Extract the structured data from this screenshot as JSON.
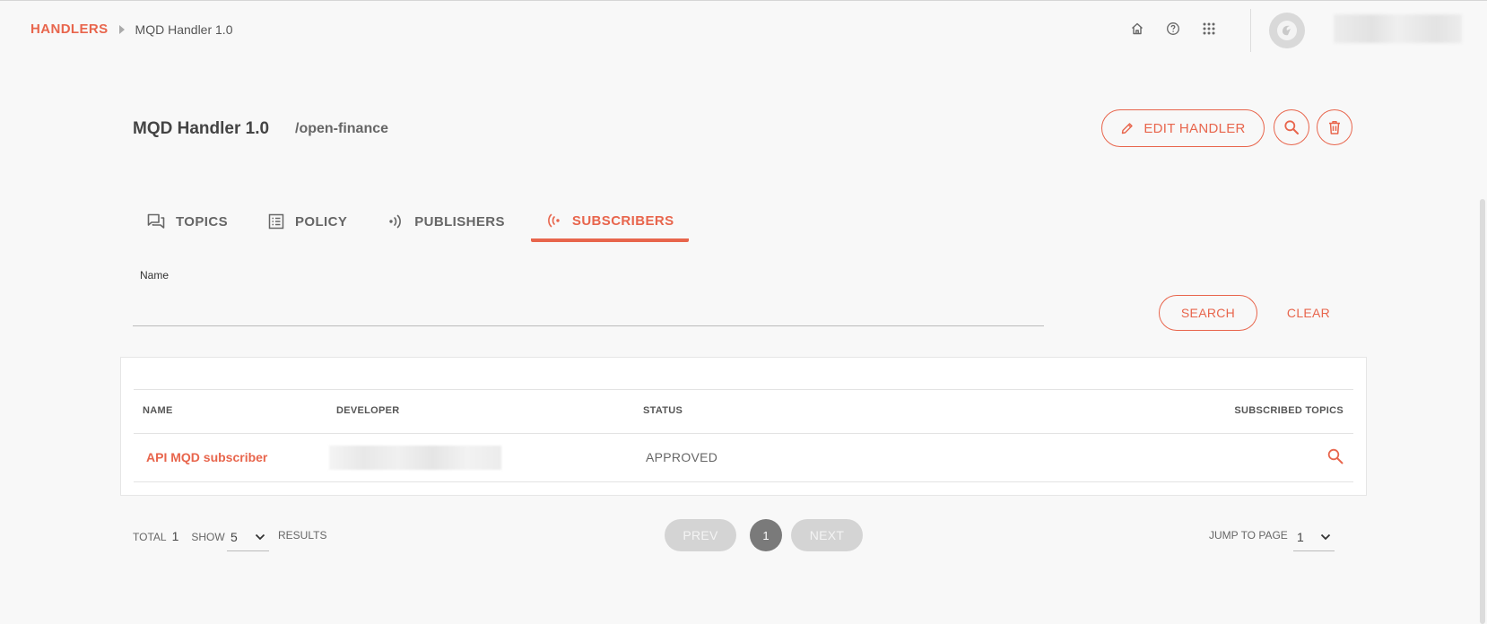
{
  "breadcrumb": {
    "root": "HANDLERS",
    "current": "MQD Handler 1.0"
  },
  "header": {
    "icons": [
      "home-icon",
      "help-icon",
      "apps-grid-icon"
    ]
  },
  "handler": {
    "title": "MQD Handler 1.0",
    "path": "/open-finance"
  },
  "actions": {
    "edit_label": "EDIT HANDLER"
  },
  "tabs": [
    {
      "label": "TOPICS",
      "icon": "topics-icon",
      "active": false
    },
    {
      "label": "POLICY",
      "icon": "policy-icon",
      "active": false
    },
    {
      "label": "PUBLISHERS",
      "icon": "publishers-icon",
      "active": false
    },
    {
      "label": "SUBSCRIBERS",
      "icon": "subscribers-icon",
      "active": true
    }
  ],
  "filter": {
    "name_label": "Name",
    "name_value": "",
    "search_label": "SEARCH",
    "clear_label": "CLEAR"
  },
  "table": {
    "columns": {
      "name": "NAME",
      "developer": "DEVELOPER",
      "status": "STATUS",
      "topics": "SUBSCRIBED TOPICS"
    },
    "rows": [
      {
        "name": "API MQD subscriber",
        "status": "APPROVED"
      }
    ]
  },
  "pagination": {
    "total_label": "TOTAL",
    "total": "1",
    "show_label": "SHOW",
    "page_size": "5",
    "results_label": "RESULTS",
    "prev_label": "PREV",
    "current_page": "1",
    "next_label": "NEXT",
    "jump_label": "JUMP TO PAGE",
    "jump_value": "1"
  },
  "colors": {
    "accent": "#e8654c",
    "background": "#f8f8f8",
    "disabled": "#d4d4d4"
  }
}
